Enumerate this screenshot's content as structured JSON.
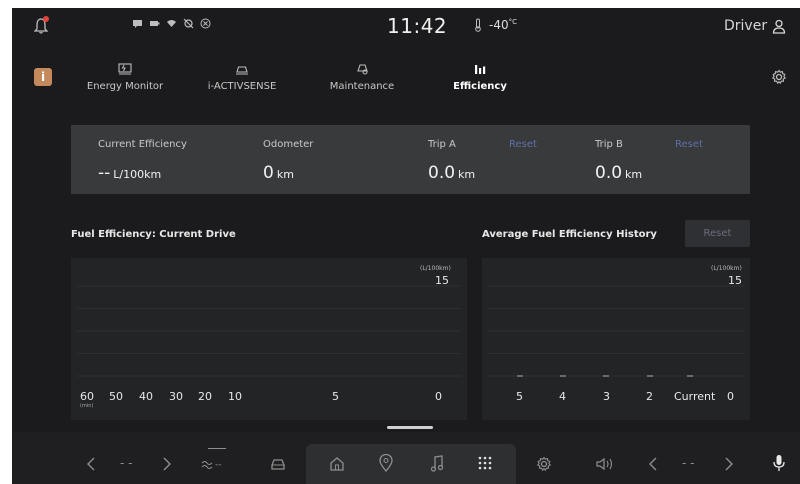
{
  "status": {
    "time": "11:42",
    "temperature": "-40",
    "temperature_unit": "°C",
    "driver_label": "Driver",
    "icons": [
      "notification-bell-icon",
      "message-icon",
      "battery-icon",
      "wifi-icon",
      "no-location-icon",
      "close-circle-icon",
      "thermometer-icon",
      "person-icon"
    ]
  },
  "tabs": [
    {
      "label": "Energy Monitor",
      "icon": "energy-monitor-icon",
      "active": false
    },
    {
      "label": "i-ACTIVSENSE",
      "icon": "car-sensor-icon",
      "active": false
    },
    {
      "label": "Maintenance",
      "icon": "maintenance-icon",
      "active": false
    },
    {
      "label": "Efficiency",
      "icon": "bar-chart-icon",
      "active": true
    }
  ],
  "summary": {
    "current_efficiency": {
      "label": "Current Efficiency",
      "value": "--",
      "unit": "L/100km"
    },
    "odometer": {
      "label": "Odometer",
      "value": "0",
      "unit": "km"
    },
    "trip_a": {
      "label": "Trip A",
      "value": "0.0",
      "unit": "km",
      "reset_label": "Reset"
    },
    "trip_b": {
      "label": "Trip B",
      "value": "0.0",
      "unit": "km",
      "reset_label": "Reset"
    }
  },
  "current_drive": {
    "title": "Fuel Efficiency: Current Drive",
    "unit_label": "(L/100km)",
    "y_max_label": "15",
    "x_unit_label": "(min)"
  },
  "history": {
    "title": "Average Fuel Efficiency History",
    "reset_label": "Reset",
    "unit_label": "(L/100km)",
    "y_max_label": "15"
  },
  "chart_data": [
    {
      "type": "line",
      "title": "Fuel Efficiency: Current Drive",
      "xlabel": "(min)",
      "ylabel": "(L/100km)",
      "x_ticks": [
        "60",
        "50",
        "40",
        "30",
        "20",
        "10",
        "5",
        "0"
      ],
      "ylim": [
        0,
        15
      ],
      "series": [],
      "grid": true
    },
    {
      "type": "bar",
      "title": "Average Fuel Efficiency History",
      "ylabel": "(L/100km)",
      "categories": [
        "5",
        "4",
        "3",
        "2",
        "Current",
        "0"
      ],
      "values": [
        null,
        null,
        null,
        null,
        null,
        null
      ],
      "ylim": [
        0,
        15
      ],
      "grid": true
    }
  ],
  "dock": {
    "left_climate_value": "- -",
    "right_climate_value": "- -",
    "fan_value": "--",
    "icons": [
      "chevron-left-icon",
      "chevron-right-icon",
      "fan-icon",
      "car-icon",
      "home-icon",
      "location-pin-icon",
      "music-note-icon",
      "apps-grid-icon",
      "settings-icon",
      "volume-icon",
      "chevron-left-icon",
      "chevron-right-icon",
      "microphone-icon"
    ]
  },
  "colors": {
    "background": "#1b1b1d",
    "panel": "#393a3c",
    "chart_bg": "#232426",
    "accent_reset": "#5e6fa8",
    "notification": "#e0463b",
    "info_badge": "#c48a5c"
  }
}
